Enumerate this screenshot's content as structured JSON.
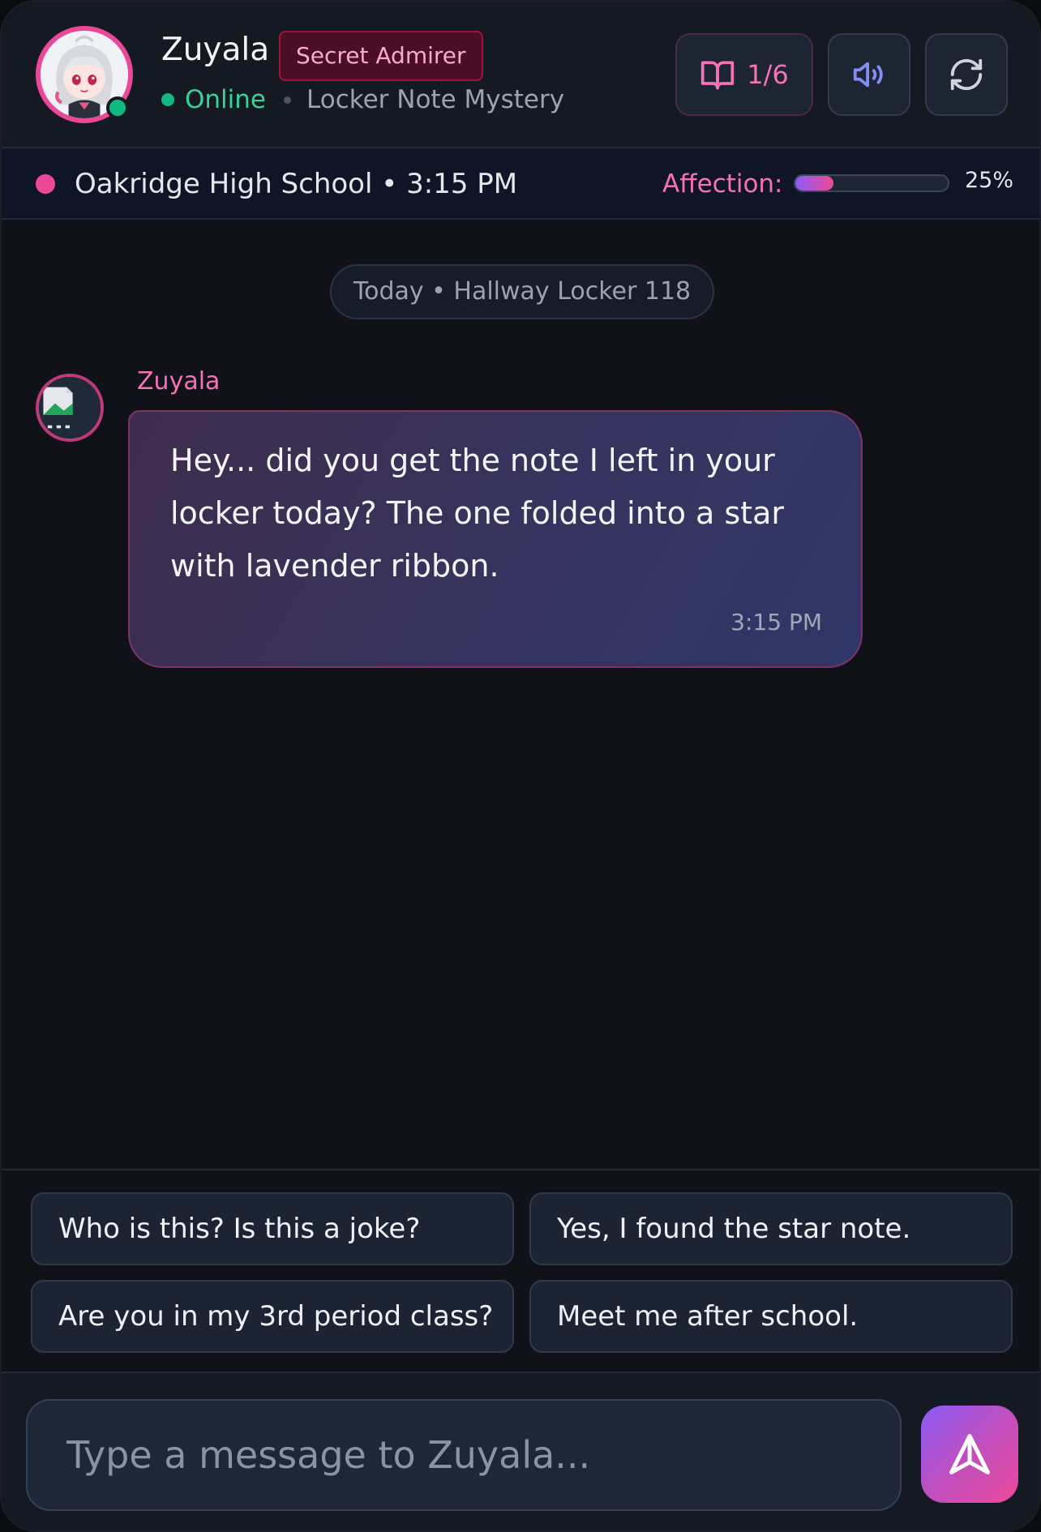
{
  "header": {
    "character_name": "Zuyala",
    "role_badge": "Secret Admirer",
    "status": "Online",
    "story_title": "Locker Note Mystery",
    "progress": "1/6",
    "icons": {
      "progress": "book-open-icon",
      "audio": "speaker-icon",
      "restart": "refresh-icon"
    }
  },
  "scene": {
    "location_time": "Oakridge High School • 3:15 PM",
    "affection_label": "Affection:",
    "affection_value": "25%",
    "affection_fraction": 0.25
  },
  "chat": {
    "date_divider": "Today • Hallway Locker 118",
    "messages": [
      {
        "sender": "Zuyala",
        "text": "Hey... did you get the note I left in your locker today? The one folded into a star with lavender ribbon.",
        "time": "3:15 PM"
      }
    ]
  },
  "quick_replies": [
    "Who is this? Is this a joke?",
    "Yes, I found the star note.",
    "Are you in my 3rd period class?",
    "Meet me after school."
  ],
  "composer": {
    "placeholder": "Type a message to Zuyala..."
  },
  "colors": {
    "accent_pink": "#ec4899",
    "accent_purple": "#8b5cf6",
    "online_green": "#10b981",
    "background": "#111217"
  }
}
